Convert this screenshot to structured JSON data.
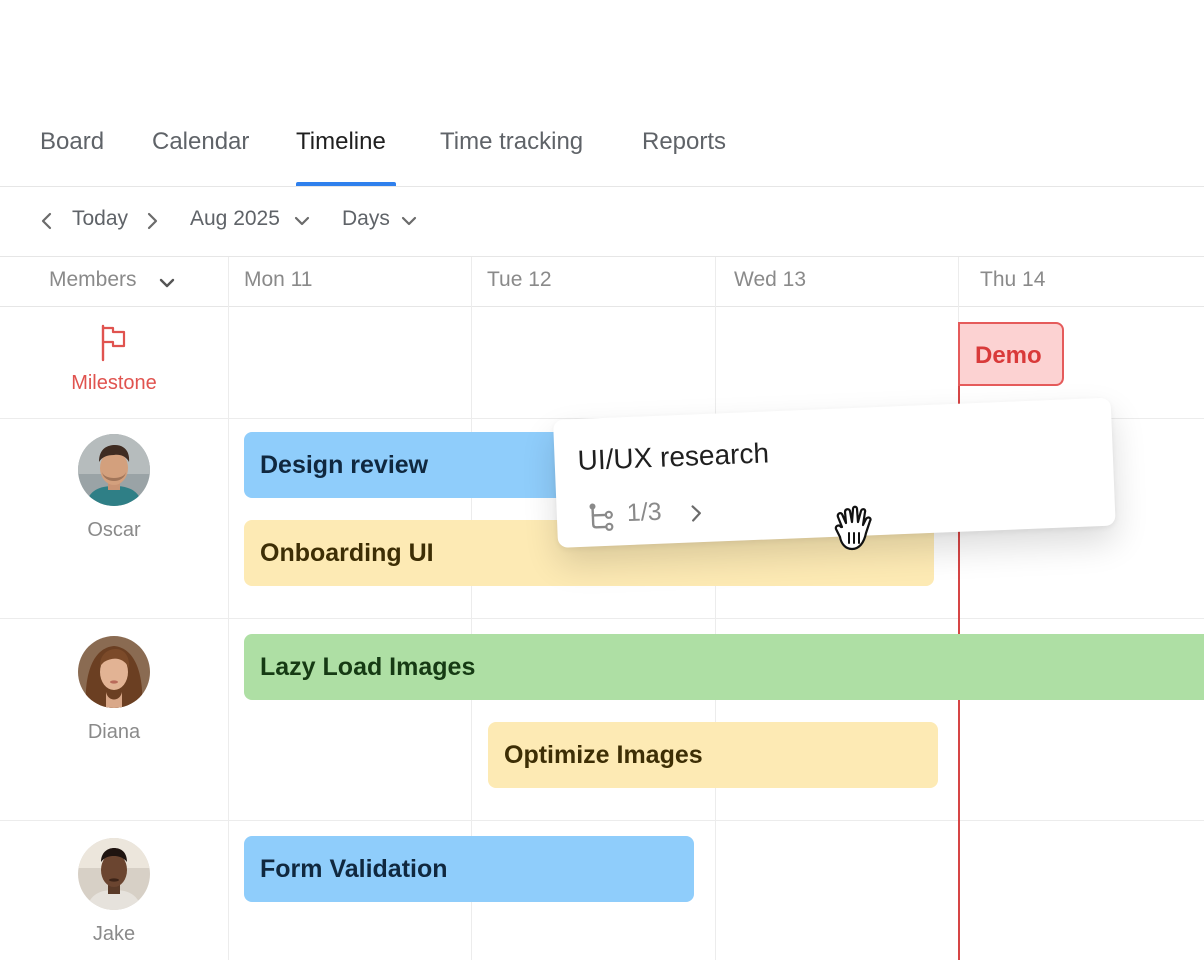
{
  "tabs": [
    {
      "label": "Board",
      "active": false
    },
    {
      "label": "Calendar",
      "active": false
    },
    {
      "label": "Timeline",
      "active": true
    },
    {
      "label": "Time tracking",
      "active": false
    },
    {
      "label": "Reports",
      "active": false
    }
  ],
  "toolbar": {
    "today_label": "Today",
    "month_label": "Aug 2025",
    "scale_label": "Days"
  },
  "grid": {
    "members_label": "Members",
    "days": [
      "Mon 11",
      "Tue 12",
      "Wed 13",
      "Thu 14"
    ]
  },
  "milestone": {
    "label": "Milestone",
    "items": [
      {
        "label": "Demo",
        "day": "Thu 14"
      }
    ]
  },
  "members": [
    {
      "name": "Oscar",
      "tasks": [
        "Design review",
        "Onboarding UI"
      ]
    },
    {
      "name": "Diana",
      "tasks": [
        "Lazy Load Images",
        "Optimize Images"
      ]
    },
    {
      "name": "Jake",
      "tasks": [
        "Form Validation"
      ]
    }
  ],
  "drag_card": {
    "title": "UI/UX research",
    "subtasks": "1/3"
  },
  "colors": {
    "accent": "#2f80ed",
    "milestone": "#e0534f",
    "today_line": "#d64545",
    "bar_blue": "#8fcdfb",
    "bar_yellow": "#fdeab4",
    "bar_green": "#aedfa4"
  },
  "icons": {
    "milestone": "flag-icon",
    "subtasks": "subtask-tree-icon",
    "cursor": "grab-hand-icon"
  }
}
